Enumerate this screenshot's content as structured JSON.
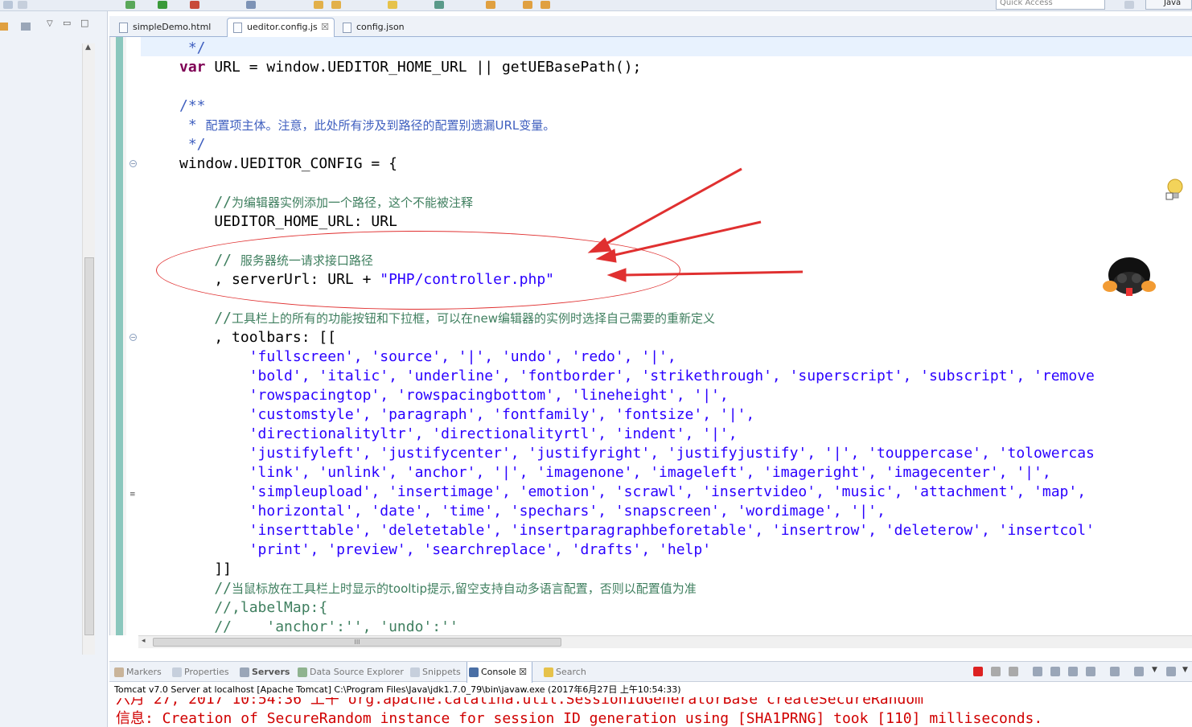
{
  "toolbar": {
    "quick_access_placeholder": "Quick Access",
    "perspective_label": "Java"
  },
  "editor_tabs": [
    {
      "label": "simpleDemo.html",
      "active": false
    },
    {
      "label": "ueditor.config.js",
      "active": true,
      "close": "☒"
    },
    {
      "label": "config.json",
      "active": false
    }
  ],
  "code": {
    "l01": " */",
    "l02_kw": "var",
    "l02_rest": " URL = window.UEDITOR_HOME_URL || getUEBasePath();",
    "l04": "/**",
    "l05_star": " * ",
    "l05_text": "配置项主体。注意，此处所有涉及到路径的配置别遗漏URL变量。",
    "l06": " */",
    "l07": "window.UEDITOR_CONFIG = {",
    "l09_slash": "    //",
    "l09_text": "为编辑器实例添加一个路径，这个不能被注释",
    "l10": "    UEDITOR_HOME_URL: URL",
    "l12_slash": "    // ",
    "l12_text": "服务器统一请求接口路径",
    "l13_pre": "    , serverUrl: URL + ",
    "l13_str": "\"PHP/controller.php\"",
    "l15_slash": "    //",
    "l15_text": "工具栏上的所有的功能按钮和下拉框，可以在new编辑器的实例时选择自己需要的重新定义",
    "l16": "    , toolbars: [[",
    "l17": "        'fullscreen', 'source', '|', 'undo', 'redo', '|',",
    "l18": "        'bold', 'italic', 'underline', 'fontborder', 'strikethrough', 'superscript', 'subscript', 'remove",
    "l19": "        'rowspacingtop', 'rowspacingbottom', 'lineheight', '|',",
    "l20": "        'customstyle', 'paragraph', 'fontfamily', 'fontsize', '|',",
    "l21": "        'directionalityltr', 'directionalityrtl', 'indent', '|',",
    "l22": "        'justifyleft', 'justifycenter', 'justifyright', 'justifyjustify', '|', 'touppercase', 'tolowercas",
    "l23": "        'link', 'unlink', 'anchor', '|', 'imagenone', 'imageleft', 'imageright', 'imagecenter', '|',",
    "l24": "        'simpleupload', 'insertimage', 'emotion', 'scrawl', 'insertvideo', 'music', 'attachment', 'map',",
    "l25": "        'horizontal', 'date', 'time', 'spechars', 'snapscreen', 'wordimage', '|',",
    "l26": "        'inserttable', 'deletetable', 'insertparagraphbeforetable', 'insertrow', 'deleterow', 'insertcol'",
    "l27": "        'print', 'preview', 'searchreplace', 'drafts', 'help'",
    "l28": "    ]]",
    "l29_slash": "    //",
    "l29_text": "当鼠标放在工具栏上时显示的tooltip提示,留空支持自动多语言配置，否则以配置值为准",
    "l30": "    //,labelMap:{",
    "l31": "    //    'anchor':'', 'undo':''"
  },
  "hscroll_grip": "III",
  "bottom_tabs": [
    {
      "label": "Markers"
    },
    {
      "label": "Properties"
    },
    {
      "label": "Servers"
    },
    {
      "label": "Data Source Explorer"
    },
    {
      "label": "Snippets"
    },
    {
      "label": "Console",
      "close": "☒"
    },
    {
      "label": "Search"
    }
  ],
  "console": {
    "header": "Tomcat v7.0 Server at localhost [Apache Tomcat] C:\\Program Files\\Java\\jdk1.7.0_79\\bin\\javaw.exe (2017年6月27日 上午10:54:33)",
    "line_partial": "六月 27, 2017 10:54:36 上午 org.apache.catalina.util.SessionIdGeneratorBase createSecureRandom",
    "line_info": "信息: Creation of SecureRandom instance for session ID generation using [SHA1PRNG] took [110] milliseconds."
  },
  "colors": {
    "keyword": "#7f0055",
    "string": "#2a00ff",
    "comment": "#3f5fbf",
    "console_error": "#d00000",
    "annotation": "#e03030"
  }
}
